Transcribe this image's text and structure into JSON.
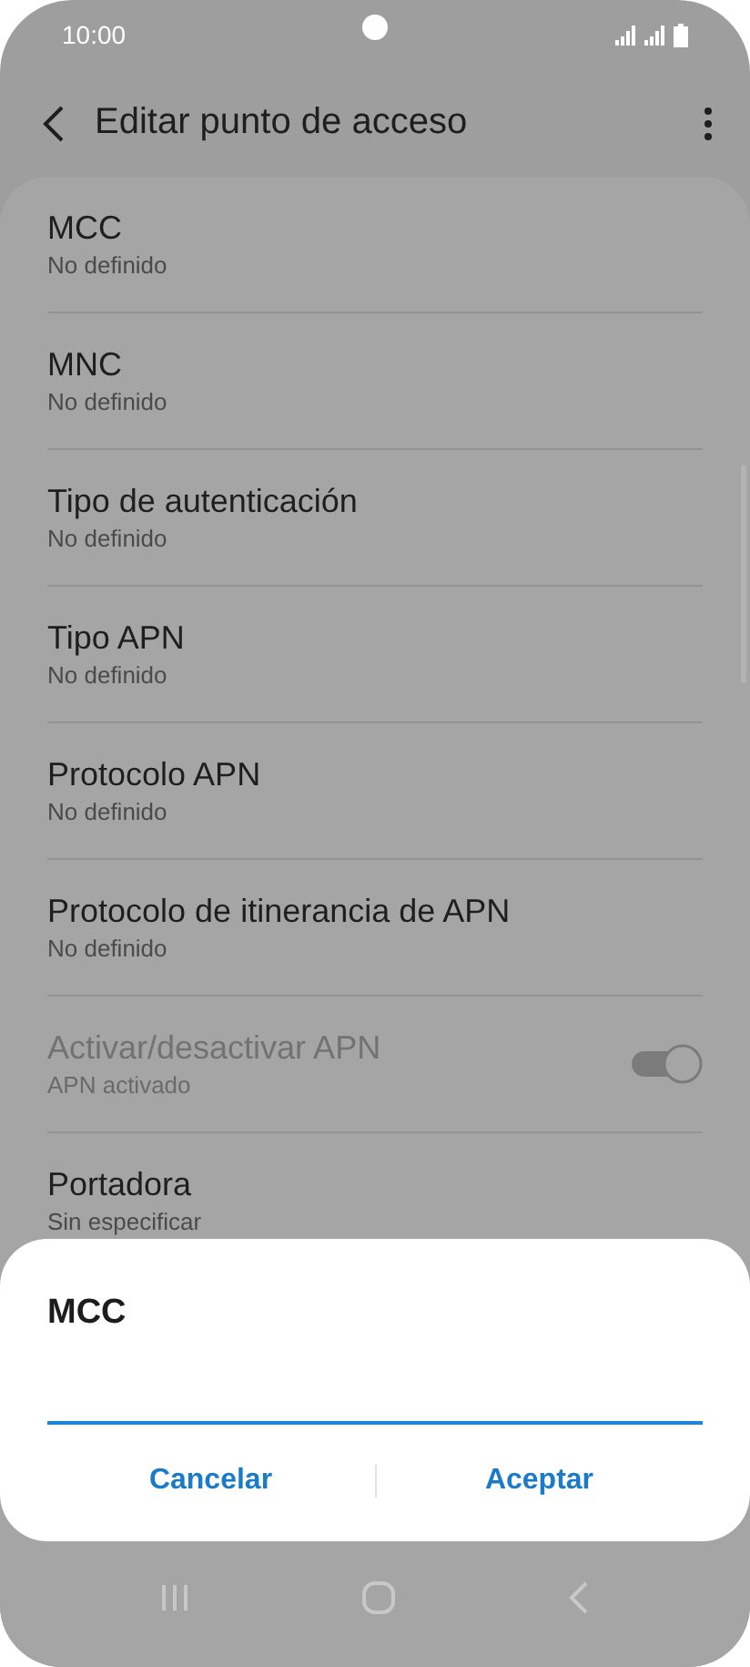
{
  "status_bar": {
    "time": "10:00"
  },
  "app_bar": {
    "title": "Editar punto de acceso"
  },
  "settings": [
    {
      "kind": "setting",
      "title": "MCC",
      "value": "No definido",
      "disabled": false
    },
    {
      "kind": "setting",
      "title": "MNC",
      "value": "No definido",
      "disabled": false
    },
    {
      "kind": "setting",
      "title": "Tipo de autenticación",
      "value": "No definido",
      "disabled": false
    },
    {
      "kind": "setting",
      "title": "Tipo APN",
      "value": "No definido",
      "disabled": false
    },
    {
      "kind": "setting",
      "title": "Protocolo APN",
      "value": "No definido",
      "disabled": false
    },
    {
      "kind": "setting",
      "title": "Protocolo de itinerancia de APN",
      "value": "No definido",
      "disabled": false
    },
    {
      "kind": "toggle",
      "title": "Activar/desactivar APN",
      "value": "APN activado",
      "disabled": true,
      "on": true
    },
    {
      "kind": "setting",
      "title": "Portadora",
      "value": "Sin especificar",
      "disabled": false
    }
  ],
  "dialog": {
    "title": "MCC",
    "buttons": [
      "Cancelar",
      "Aceptar"
    ]
  }
}
